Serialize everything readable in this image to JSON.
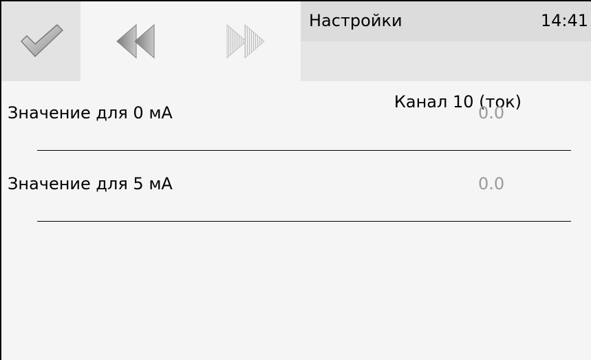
{
  "header": {
    "title": "Настройки",
    "time": "14:41",
    "subtitle": "Канал 10 (ток)"
  },
  "toolbar": {
    "confirm_icon": "checkmark-icon",
    "prev_icon": "rewind-icon",
    "next_icon": "fast-forward-icon",
    "next_enabled": false
  },
  "settings": {
    "rows": [
      {
        "label": "Значение для 0 мА",
        "value": "0.0"
      },
      {
        "label": "Значение для 5 мА",
        "value": "0.0"
      }
    ]
  },
  "colors": {
    "background": "#f5f5f5",
    "header_top": "#dcdcdc",
    "header_bottom": "#e6e6e6",
    "value_text": "#9a9a9a"
  }
}
